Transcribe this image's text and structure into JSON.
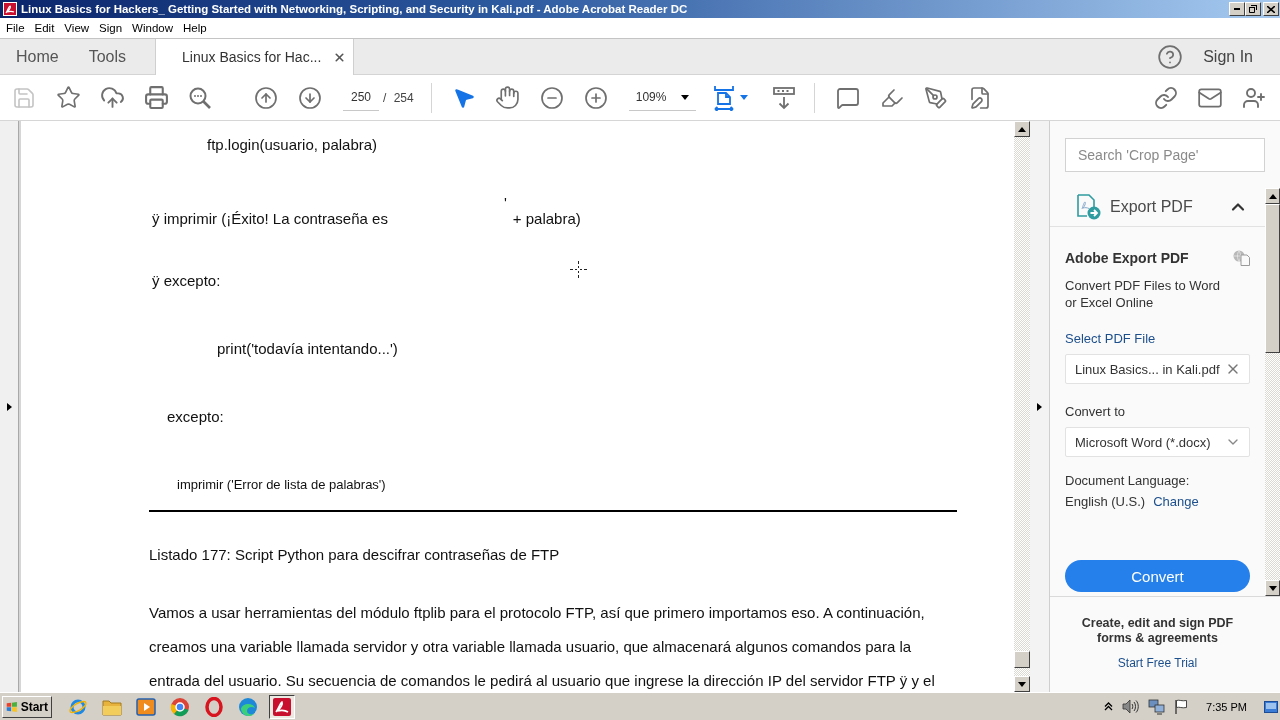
{
  "window": {
    "title": "Linux Basics for Hackers_ Getting Started with Networking, Scripting, and Security in Kali.pdf - Adobe Acrobat Reader DC"
  },
  "menu_bar": [
    "File",
    "Edit",
    "View",
    "Sign",
    "Window",
    "Help"
  ],
  "tabs": [
    {
      "label": "Home",
      "selected": false,
      "closable": false
    },
    {
      "label": "Tools",
      "selected": false,
      "closable": false
    },
    {
      "label": "Linux Basics for Hac...",
      "selected": true,
      "closable": true
    }
  ],
  "account": {
    "sign_in": "Sign In"
  },
  "toolbar": {
    "save_disabled": true,
    "page_current": "250",
    "page_total": "/ 254",
    "pointer_tools": [
      {
        "selected": true
      },
      {
        "selected": false
      }
    ],
    "zoom": "109%"
  },
  "document": {
    "code_lines": [
      [
        "ftp.login(usuario, palabra)"
      ],
      [
        "ÿ imprimir (¡Éxito! La contraseña es",
        "'",
        "+ palabra)"
      ],
      [
        "ÿ excepto:"
      ],
      [
        "print('todavía intentando...')"
      ],
      [
        "excepto:"
      ],
      [
        "imprimir ('Error de lista de palabras')"
      ]
    ],
    "caption": "Listado 177: Script Python para descifrar contraseñas de FTP",
    "paragraph": "Vamos a usar herramientas del módulo ftplib para el protocolo FTP, así que primero importamos eso. A continuación, creamos una variable llamada servidor y otra variable llamada usuario, que almacenará algunos comandos para la entrada del usuario. Su secuencia de comandos le pedirá al usuario que ingrese la dirección IP del servidor FTP ÿ y el"
  },
  "right_panel": {
    "search": {
      "placeholder": "Search 'Crop Page'"
    },
    "export": {
      "title": "Export PDF",
      "expanded": true,
      "heading": "Adobe Export PDF",
      "description": "Convert PDF Files to Word or Excel Online",
      "select_link": "Select PDF File",
      "file": "Linux Basics... in Kali.pdf",
      "convert_to_label": "Convert to",
      "format": "Microsoft Word (*.docx)",
      "language_label": "Document Language:",
      "language": "English (U.S.)",
      "change_link": "Change",
      "button": "Convert"
    },
    "promo": {
      "text": "Create, edit and sign PDF forms & agreements",
      "link": "Start Free Trial"
    }
  },
  "taskbar": {
    "start": "Start",
    "apps": [
      {
        "selected": false
      },
      {
        "selected": false
      },
      {
        "selected": false
      },
      {
        "selected": false
      },
      {
        "selected": false
      },
      {
        "selected": false
      },
      {
        "selected": true
      }
    ],
    "clock": "7:35 PM"
  }
}
